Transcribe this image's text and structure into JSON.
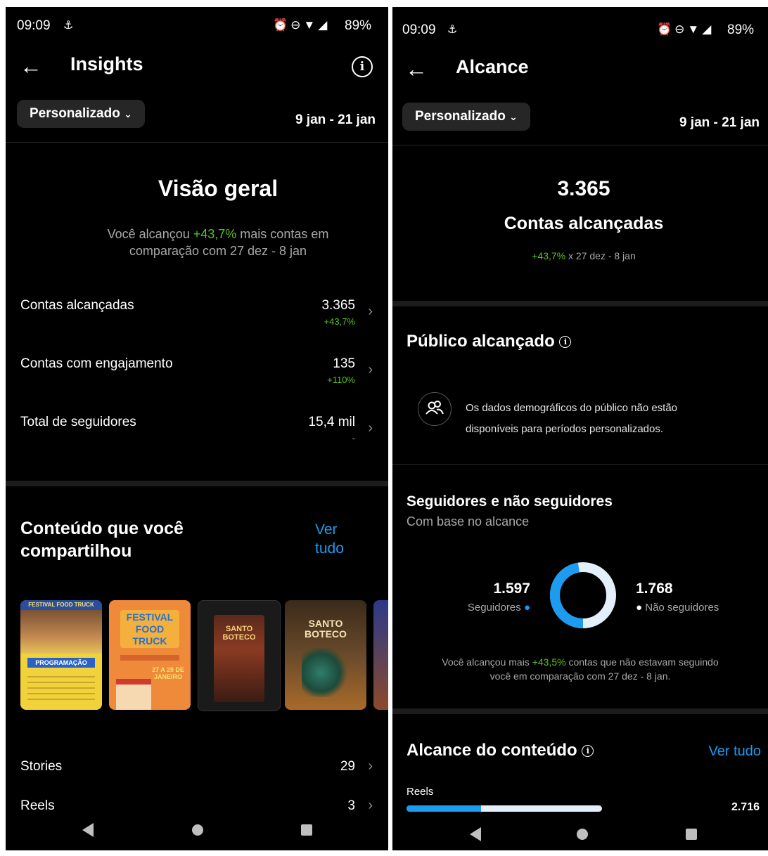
{
  "left": {
    "status": {
      "time": "09:09",
      "battery": "89%"
    },
    "header": {
      "title": "Insights"
    },
    "filter": {
      "label": "Personalizado",
      "range": "9 jan - 21 jan"
    },
    "overview": {
      "heading": "Visão geral",
      "summary_prefix": "Você alcançou ",
      "summary_pct": "+43,7%",
      "summary_suffix_1": " mais contas em",
      "summary_line2": "comparação com 27 dez - 8 jan"
    },
    "metrics": [
      {
        "label": "Contas alcançadas",
        "value": "3.365",
        "change": "+43,7%"
      },
      {
        "label": "Contas com engajamento",
        "value": "135",
        "change": "+110%"
      },
      {
        "label": "Total de seguidores",
        "value": "15,4 mil",
        "change": "-"
      }
    ],
    "content": {
      "heading_line1": "Conteúdo que você",
      "heading_line2": "compartilhou",
      "see_all_1": "Ver",
      "see_all_2": "tudo"
    },
    "thumbs": [
      {
        "top": "FESTIVAL FOOD TRUCK",
        "bottom": "PROGRAMAÇÃO"
      },
      {
        "top": "FESTIVAL FOOD TRUCK",
        "bottom": "27 A 29 DE JANEIRO"
      },
      {
        "top": "SANTO BOTECO",
        "bottom": ""
      },
      {
        "top": "SANTO BOTECO",
        "bottom": ""
      }
    ],
    "lists": [
      {
        "label": "Stories",
        "value": "29"
      },
      {
        "label": "Reels",
        "value": "3"
      }
    ]
  },
  "right": {
    "status": {
      "time": "09:09",
      "battery": "89%"
    },
    "header": {
      "title": "Alcance"
    },
    "filter": {
      "label": "Personalizado",
      "range": "9 jan - 21 jan"
    },
    "reach": {
      "value": "3.365",
      "label": "Contas alcançadas",
      "pct": "+43,7%",
      "compare": " x 27 dez - 8 jan"
    },
    "audience": {
      "heading": "Público alcançado",
      "notice_1": "Os dados demográficos do público não estão",
      "notice_2": "disponíveis para períodos personalizados."
    },
    "followers": {
      "heading": "Seguidores e não seguidores",
      "subheading": "Com base no alcance",
      "followers_value": "1.597",
      "followers_label": "Seguidores",
      "non_followers_value": "1.768",
      "non_followers_label": "Não seguidores",
      "followers_fraction": 0.4746,
      "note_prefix": "Você alcançou mais ",
      "note_pct": "+43,5%",
      "note_suffix": " contas que não estavam seguindo",
      "note_line2": "você em comparação com 27 dez - 8 jan."
    },
    "content_reach": {
      "heading": "Alcance do conteúdo",
      "see_all": "Ver tudo",
      "item_label": "Reels",
      "item_value": "2.716",
      "followers_fraction": 0.38
    }
  },
  "colors": {
    "accent_blue": "#1d9bf0",
    "positive_green": "#58c322",
    "donut_light": "#e3effb"
  }
}
